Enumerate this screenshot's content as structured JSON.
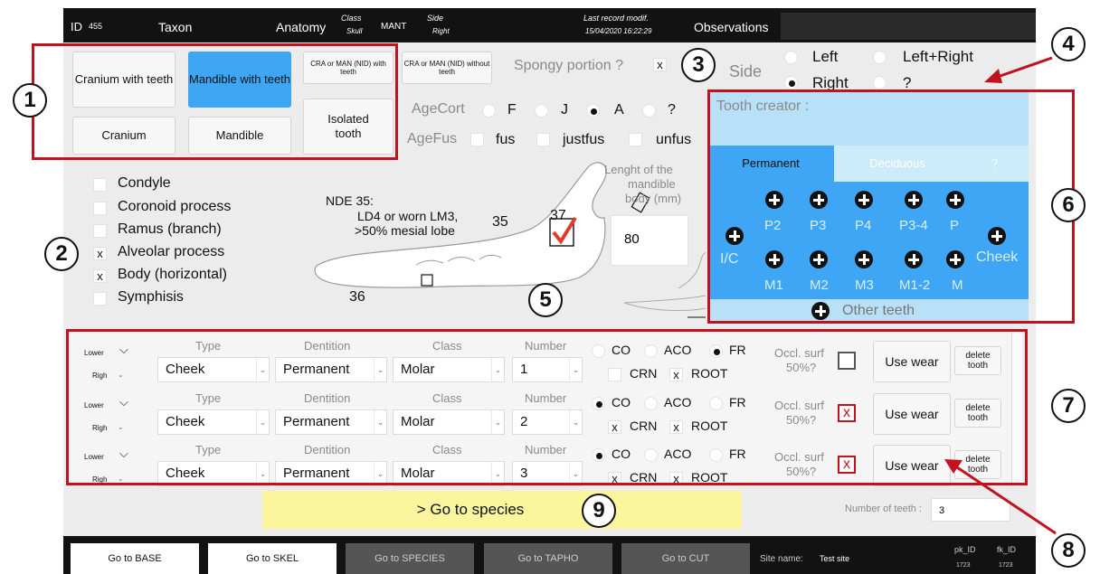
{
  "top": {
    "id_label": "ID",
    "id_value": "455",
    "taxon": "Taxon",
    "anatomy": "Anatomy",
    "class_label": "Class",
    "class_value": "Skull",
    "mant": "MANT",
    "side_label": "Side",
    "side_value": "Right",
    "last_modif_label": "Last record modif.",
    "last_modif_value": "15/04/2020 16:22:29",
    "observations": "Observations"
  },
  "element_buttons": {
    "cranium_teeth": "Cranium with teeth",
    "mandible_teeth": "Mandible with teeth",
    "cra_man_with": "CRA or MAN (NID) with teeth",
    "cra_man_without": "CRA or MAN (NID) without teeth",
    "cranium": "Cranium",
    "mandible": "Mandible",
    "isolated": "Isolated tooth",
    "active": "Mandible with teeth"
  },
  "spongy": {
    "label": "Spongy portion ?",
    "checked": "x"
  },
  "side": {
    "label": "Side",
    "options": [
      "Left",
      "Left+Right",
      "Right",
      "?"
    ],
    "selected": "Right"
  },
  "age_cort": {
    "label": "AgeCort",
    "options": [
      "F",
      "J",
      "A",
      "?"
    ],
    "selected": "A"
  },
  "age_fus": {
    "label": "AgeFus",
    "options": [
      "fus",
      "justfus",
      "unfus"
    ]
  },
  "parts": [
    {
      "label": "Condyle",
      "mark": ""
    },
    {
      "label": "Coronoid process",
      "mark": ""
    },
    {
      "label": "Ramus (branch)",
      "mark": ""
    },
    {
      "label": "Alveolar process",
      "mark": "x"
    },
    {
      "label": "Body (horizontal)",
      "mark": "x"
    },
    {
      "label": "Symphisis",
      "mark": ""
    }
  ],
  "diagram": {
    "nde_line1": "NDE 35:",
    "nde_line2": "LD4 or worn LM3,",
    "nde_line3": ">50% mesial lobe",
    "n35": "35",
    "n37": "37",
    "n36": "36",
    "length_label": "Lenght of the mandible body (mm)",
    "length_line1": "Lenght of the",
    "length_line2": "mandible",
    "length_line3": "body (mm)",
    "length_value": "80"
  },
  "tooth_creator": {
    "title": "Tooth creator :",
    "tabs": [
      "Permanent",
      "Deciduous",
      "?"
    ],
    "active_tab": "Permanent",
    "ic": "I/C",
    "cheek": "Cheek",
    "top_labels": [
      "P2",
      "P3",
      "P4",
      "P3-4",
      "P"
    ],
    "bottom_labels": [
      "M1",
      "M2",
      "M3",
      "M1-2",
      "M"
    ],
    "other": "Other teeth"
  },
  "table": {
    "col_type": "Type",
    "col_dentition": "Dentition",
    "col_class": "Class",
    "col_number": "Number",
    "occl_line1": "Occl. surf",
    "occl_line2": "50%?",
    "use_wear": "Use wear",
    "delete_line1": "delete",
    "delete_line2": "tooth",
    "rows": [
      {
        "jaw": "Lower",
        "side": "Righ",
        "type": "Cheek",
        "dentition": "Permanent",
        "class": "Molar",
        "number": "1",
        "state": "FR",
        "crn": "",
        "root": "x",
        "occl": ""
      },
      {
        "jaw": "Lower",
        "side": "Righ",
        "type": "Cheek",
        "dentition": "Permanent",
        "class": "Molar",
        "number": "2",
        "state": "CO",
        "crn": "x",
        "root": "x",
        "occl": "x"
      },
      {
        "jaw": "Lower",
        "side": "Righ",
        "type": "Cheek",
        "dentition": "Permanent",
        "class": "Molar",
        "number": "3",
        "state": "CO",
        "crn": "x",
        "root": "x",
        "occl": "x"
      }
    ],
    "states": [
      "CO",
      "ACO",
      "FR"
    ],
    "crn": "CRN",
    "root": "ROOT"
  },
  "go_species": "> Go to species",
  "number_of_teeth": {
    "label": "Number of teeth :",
    "value": "3"
  },
  "footer": {
    "buttons": [
      "Go to BASE",
      "Go to SKEL",
      "Go to SPECIES",
      "Go to TAPHO",
      "Go to CUT"
    ],
    "site_label": "Site name:",
    "site_value": "Test site",
    "pk_label": "pk_ID",
    "pk_value": "1723",
    "fk_label": "fk_ID",
    "fk_value": "1723"
  },
  "callouts": [
    "1",
    "2",
    "3",
    "4",
    "5",
    "6",
    "7",
    "8",
    "9"
  ],
  "colors": {
    "accent": "#3ea6f4",
    "panel": "#b8e0f7",
    "annotation": "#c1121f",
    "species_button": "#fbf59e",
    "dark": "#121212"
  }
}
